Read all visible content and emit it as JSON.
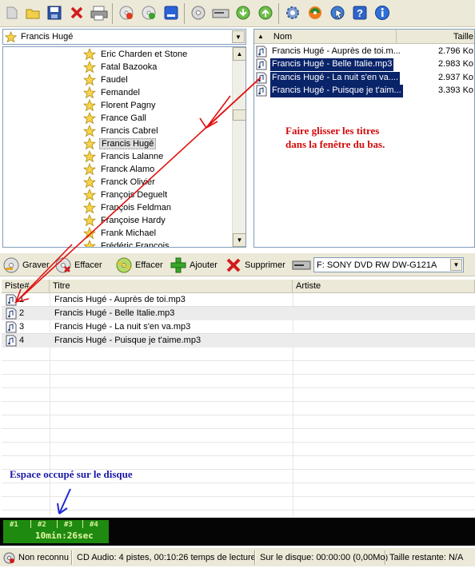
{
  "folder_combo": {
    "value": "Francis Hugé"
  },
  "tree": {
    "items": [
      {
        "label": "Eric Charden et Stone",
        "selected": false
      },
      {
        "label": "Fatal Bazooka",
        "selected": false
      },
      {
        "label": "Faudel",
        "selected": false
      },
      {
        "label": "Femandel",
        "selected": false
      },
      {
        "label": "Florent Pagny",
        "selected": false
      },
      {
        "label": "France Gall",
        "selected": false
      },
      {
        "label": "Francis Cabrel",
        "selected": false
      },
      {
        "label": "Francis Hugé",
        "selected": true
      },
      {
        "label": "Francis Lalanne",
        "selected": false
      },
      {
        "label": "Franck Alamo",
        "selected": false
      },
      {
        "label": "Franck Olivier",
        "selected": false
      },
      {
        "label": "François Deguelt",
        "selected": false
      },
      {
        "label": "François Feldman",
        "selected": false
      },
      {
        "label": "Françoise Hardy",
        "selected": false
      },
      {
        "label": "Frank Michael",
        "selected": false
      },
      {
        "label": "Frédéric François",
        "selected": false
      }
    ]
  },
  "file_list": {
    "columns": {
      "name": "Nom",
      "size": "Taille"
    },
    "files": [
      {
        "name": "Francis Hugé - Auprès de toi.m...",
        "size": "2.796 Ko",
        "selected": false
      },
      {
        "name": "Francis Hugé - Belle Italie.mp3",
        "size": "2.983 Ko",
        "selected": true
      },
      {
        "name": "Francis Hugé - La nuit s'en va....",
        "size": "2.937 Ko",
        "selected": true
      },
      {
        "name": "Francis Hugé - Puisque je t'aim...",
        "size": "3.393 Ko",
        "selected": true
      }
    ]
  },
  "annotations": {
    "drag_hint_line1": "Faire glisser les titres",
    "drag_hint_line2": "dans la fenêtre du bas.",
    "space_hint": "Espace occupé sur le disque"
  },
  "burn_toolbar": {
    "burn": "Graver",
    "erase_disc": "Effacer",
    "clear": "Effacer",
    "add": "Ajouter",
    "remove": "Supprimer",
    "drive": "F: SONY DVD RW DW-G121A"
  },
  "tracks": {
    "columns": {
      "track": "Piste#",
      "title": "Titre",
      "artist": "Artiste"
    },
    "rows": [
      {
        "num": "1",
        "title": "Francis Hugé - Auprès de toi.mp3",
        "artist": ""
      },
      {
        "num": "2",
        "title": "Francis Hugé - Belle Italie.mp3",
        "artist": ""
      },
      {
        "num": "3",
        "title": "Francis Hugé - La nuit s'en va.mp3",
        "artist": ""
      },
      {
        "num": "4",
        "title": "Francis Hugé - Puisque je t'aime.mp3",
        "artist": ""
      }
    ]
  },
  "capacity": {
    "segments": [
      "#1",
      "#2",
      "#3",
      "#4"
    ],
    "time": "10min:26sec",
    "used_fraction": 0.225
  },
  "status": {
    "disc": "Non reconnu",
    "audio": "CD Audio: 4 pistes, 00:10:26 temps de lecture",
    "on_disc": "Sur le disque: 00:00:00 (0,00Mo)",
    "remaining": "Taille restante: N/A"
  },
  "colors": {
    "selection": "#0a246a",
    "capacity_fill": "#1f8a10",
    "annotation_red": "#d10a0a",
    "annotation_blue": "#1a1aa8"
  }
}
